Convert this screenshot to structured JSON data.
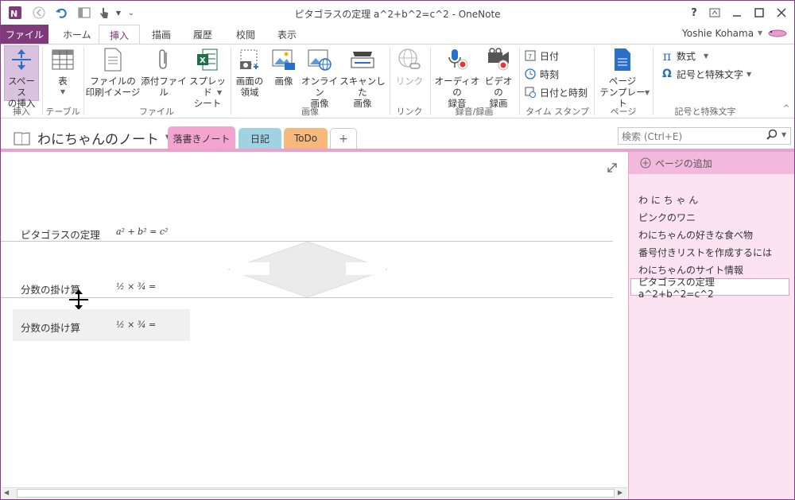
{
  "window": {
    "title": "ピタゴラスの定理  a^2+b^2=c^2 - OneNote"
  },
  "tabs": [
    {
      "label": "ファイル"
    },
    {
      "label": "ホーム"
    },
    {
      "label": "挿入"
    },
    {
      "label": "描画"
    },
    {
      "label": "履歴"
    },
    {
      "label": "校閲"
    },
    {
      "label": "表示"
    }
  ],
  "user": {
    "name": "Yoshie Kohama"
  },
  "ribbon": {
    "insert_space": {
      "line1": "スペース",
      "line2": "の挿入"
    },
    "table": {
      "label": "表"
    },
    "file_printout": {
      "line1": "ファイルの",
      "line2": "印刷イメージ"
    },
    "attach_file": {
      "label": "添付ファイル"
    },
    "spreadsheet": {
      "line1": "スプレッド",
      "line2": "シート"
    },
    "screen_clip": {
      "line1": "画面の",
      "line2": "領域"
    },
    "picture": {
      "label": "画像"
    },
    "online_picture": {
      "line1": "オンライン",
      "line2": "画像"
    },
    "scanned": {
      "line1": "スキャンした",
      "line2": "画像"
    },
    "link": {
      "label": "リンク"
    },
    "audio": {
      "line1": "オーディオの",
      "line2": "録音"
    },
    "video": {
      "line1": "ビデオの",
      "line2": "録画"
    },
    "date": {
      "label": "日付"
    },
    "time": {
      "label": "時刻"
    },
    "datetime": {
      "label": "日付と時刻"
    },
    "page_templates": {
      "line1": "ページ",
      "line2": "テンプレート"
    },
    "equation": {
      "label": "数式"
    },
    "symbol": {
      "label": "記号と特殊文字"
    },
    "groups": {
      "insert": "挿入",
      "tables": "テーブル",
      "files": "ファイル",
      "images": "画像",
      "links": "リンク",
      "recording": "録音/録画",
      "timestamp": "タイム スタンプ",
      "pages": "ページ",
      "symbols": "記号と特殊文字"
    }
  },
  "notebook": {
    "name": "わにちゃんのノート",
    "sections": [
      {
        "label": "落書きノート",
        "color": "#f3a4cf"
      },
      {
        "label": "日記",
        "color": "#9fd3e3"
      },
      {
        "label": "ToDo",
        "color": "#f7b97b"
      },
      {
        "label": "+",
        "color": "#ffffff"
      }
    ]
  },
  "search": {
    "placeholder": "検索 (Ctrl+E)"
  },
  "page": {
    "line1": {
      "label": "ピタゴラスの定理",
      "equation": "a² + b² = c²"
    },
    "line2": {
      "label": "分数の掛け算",
      "equation": "½ × ¾ ="
    },
    "line3": {
      "label": "分数の掛け算",
      "equation": "½ × ¾ ="
    }
  },
  "pages_pane": {
    "add_page": "ページの追加",
    "pages": [
      {
        "title": "わ に ち ゃ ん"
      },
      {
        "title": "ピンクのワニ"
      },
      {
        "title": "わにちゃんの好きな食べ物"
      },
      {
        "title": "番号付きリストを作成するには"
      },
      {
        "title": "わにちゃんのサイト情報"
      }
    ],
    "selected": "ピタゴラスの定理  a^2+b^2=c^2"
  }
}
